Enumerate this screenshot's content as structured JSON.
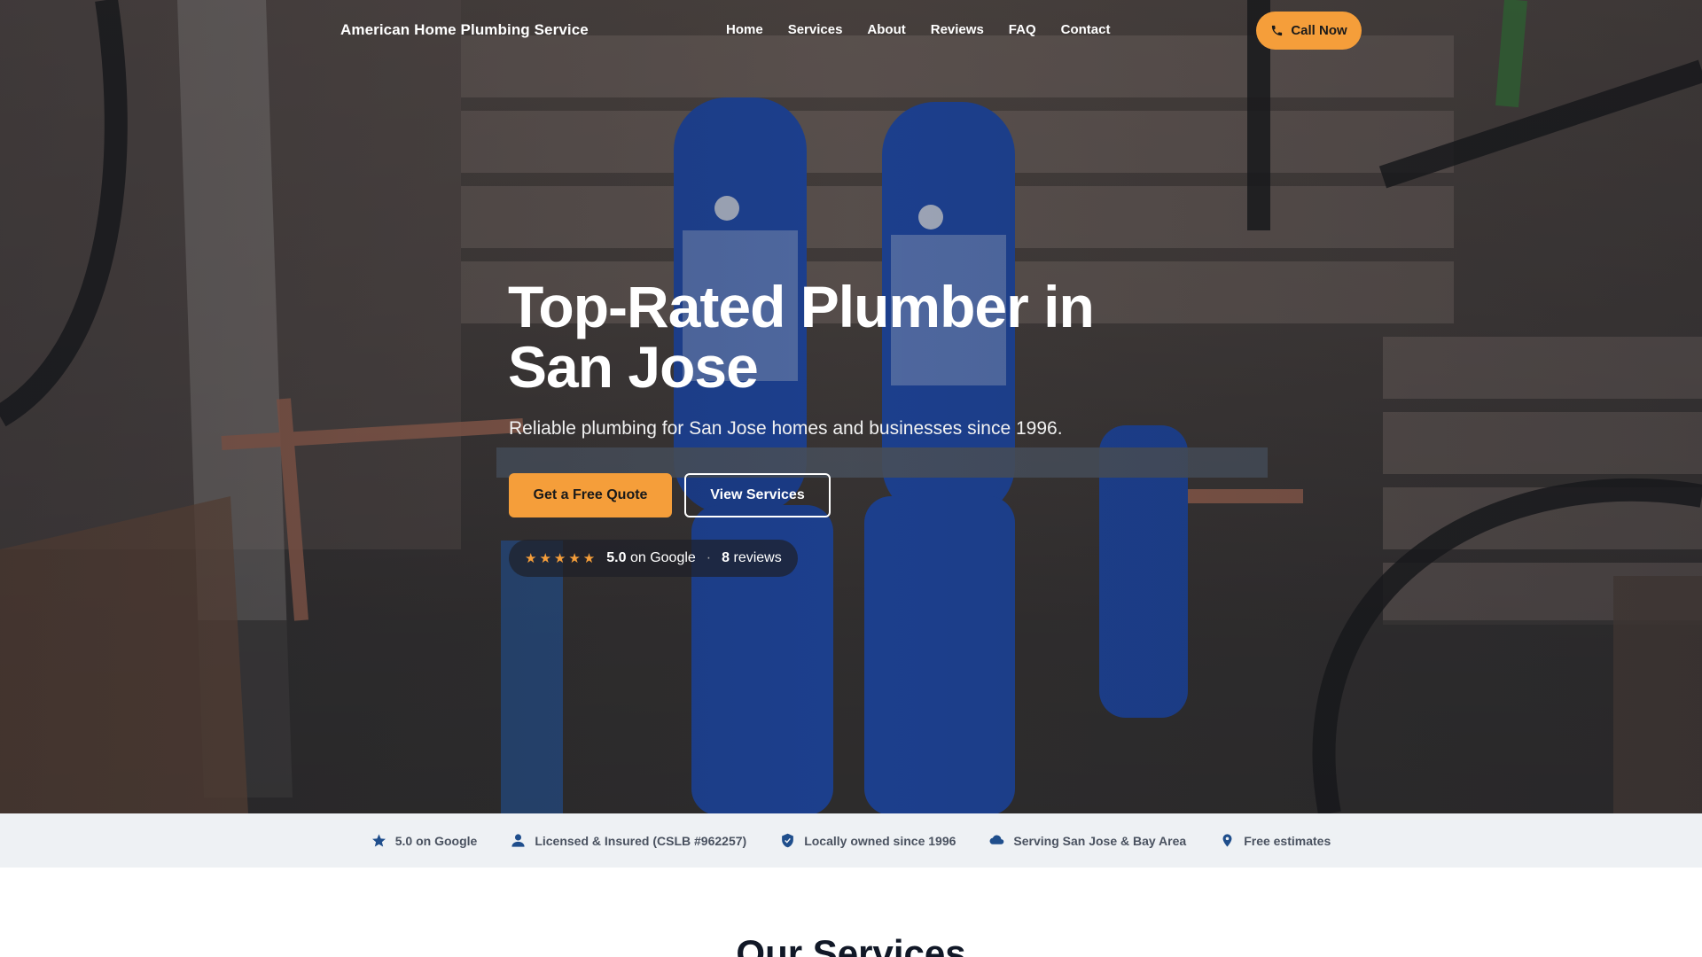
{
  "nav": {
    "brand": "American Home Plumbing Service",
    "links": [
      "Home",
      "Services",
      "About",
      "Reviews",
      "FAQ",
      "Contact"
    ],
    "call_label": "Call Now",
    "call_icon": "phone-icon"
  },
  "hero": {
    "title": "Top-Rated Plumber in San Jose",
    "subtitle": "Reliable plumbing for San Jose homes and businesses since 1996.",
    "primary_cta": "Get a Free Quote",
    "secondary_cta": "View Services",
    "rating": {
      "stars": "★★★★★",
      "score": "5.0",
      "source": "on Google",
      "separator": "·",
      "review_count": "8",
      "review_label": "reviews"
    }
  },
  "trust_bar": [
    {
      "icon": "star-icon",
      "label": "5.0 on Google"
    },
    {
      "icon": "person-icon",
      "label": "Licensed & Insured (CSLB #962257)"
    },
    {
      "icon": "shield-check-icon",
      "label": "Locally owned since 1996"
    },
    {
      "icon": "cloud-icon",
      "label": "Serving San Jose & Bay Area"
    },
    {
      "icon": "map-pin-icon",
      "label": "Free estimates"
    }
  ],
  "services": {
    "heading": "Our Services"
  },
  "colors": {
    "accent": "#f59e3a",
    "trust_bg": "#eef1f4",
    "trust_icon": "#1f4e8c"
  }
}
